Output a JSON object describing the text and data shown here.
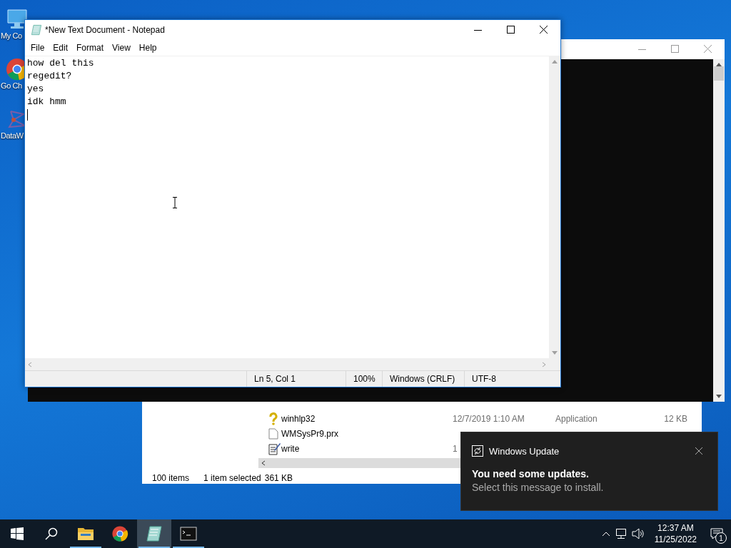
{
  "desktop_icons": [
    {
      "kind": "computer",
      "label": "My Co"
    },
    {
      "kind": "chrome",
      "label": "Go Ch"
    },
    {
      "kind": "molecule",
      "label": "DataW"
    }
  ],
  "explorer": {
    "rows": [
      {
        "kind": "help",
        "name": "winhlp32",
        "date": "12/7/2019 1:10 AM",
        "type": "Application",
        "size": "12 KB"
      },
      {
        "kind": "file",
        "name": "WMSysPr9.prx"
      },
      {
        "kind": "write",
        "name": "write",
        "date": "1"
      }
    ],
    "status": [
      "100 items",
      "1 item selected",
      "361 KB"
    ]
  },
  "notepad": {
    "title": "*New Text Document - Notepad",
    "menu": [
      "File",
      "Edit",
      "Format",
      "View",
      "Help"
    ],
    "lines": [
      "how del this",
      "regedit?",
      "yes",
      "idk hmm"
    ],
    "status": [
      "Ln 5, Col 1",
      "100%",
      "Windows (CRLF)",
      "UTF-8"
    ]
  },
  "toast": {
    "app": "Windows Update",
    "title": "You need some updates.",
    "message": "Select this message to install."
  },
  "taskbar": {
    "apps": [
      {
        "kind": "explorer",
        "running": true,
        "selected": false
      },
      {
        "kind": "chrome",
        "running": false,
        "selected": false
      },
      {
        "kind": "notepad",
        "running": true,
        "selected": true
      },
      {
        "kind": "console",
        "running": true,
        "selected": false
      }
    ],
    "time": "12:37 AM",
    "date": "11/25/2022",
    "notifications": "1"
  }
}
